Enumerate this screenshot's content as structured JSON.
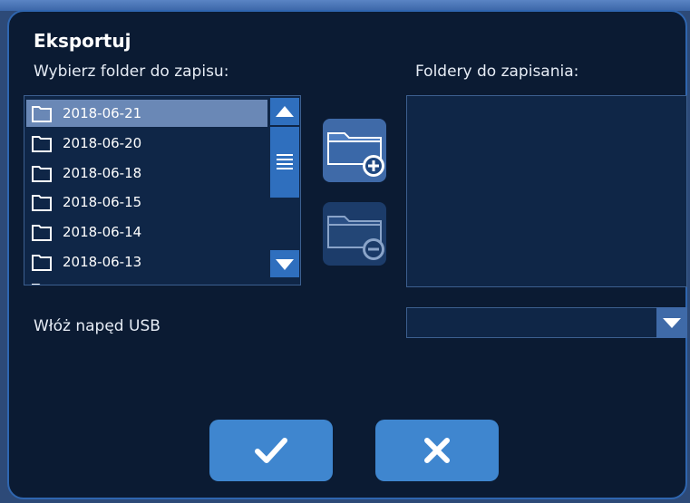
{
  "dialog": {
    "title": "Eksportuj",
    "source_label": "Wybierz folder do zapisu:",
    "target_label": "Foldery do zapisania:",
    "usb_label": "Włóż napęd USB"
  },
  "folders": [
    {
      "name": "2018-06-21",
      "selected": true
    },
    {
      "name": "2018-06-20",
      "selected": false
    },
    {
      "name": "2018-06-18",
      "selected": false
    },
    {
      "name": "2018-06-15",
      "selected": false
    },
    {
      "name": "2018-06-14",
      "selected": false
    },
    {
      "name": "2018-06-13",
      "selected": false
    }
  ],
  "icons": {
    "add": "folder-add-icon",
    "remove": "folder-remove-icon",
    "confirm": "checkmark-icon",
    "cancel": "x-icon",
    "scroll_up": "triangle-up-icon",
    "scroll_down": "triangle-down-icon",
    "dropdown": "chevron-down-icon"
  },
  "colors": {
    "dialog_bg": "#0b1b33",
    "accent": "#3f86cf",
    "selected_row": "#6a88b6"
  }
}
